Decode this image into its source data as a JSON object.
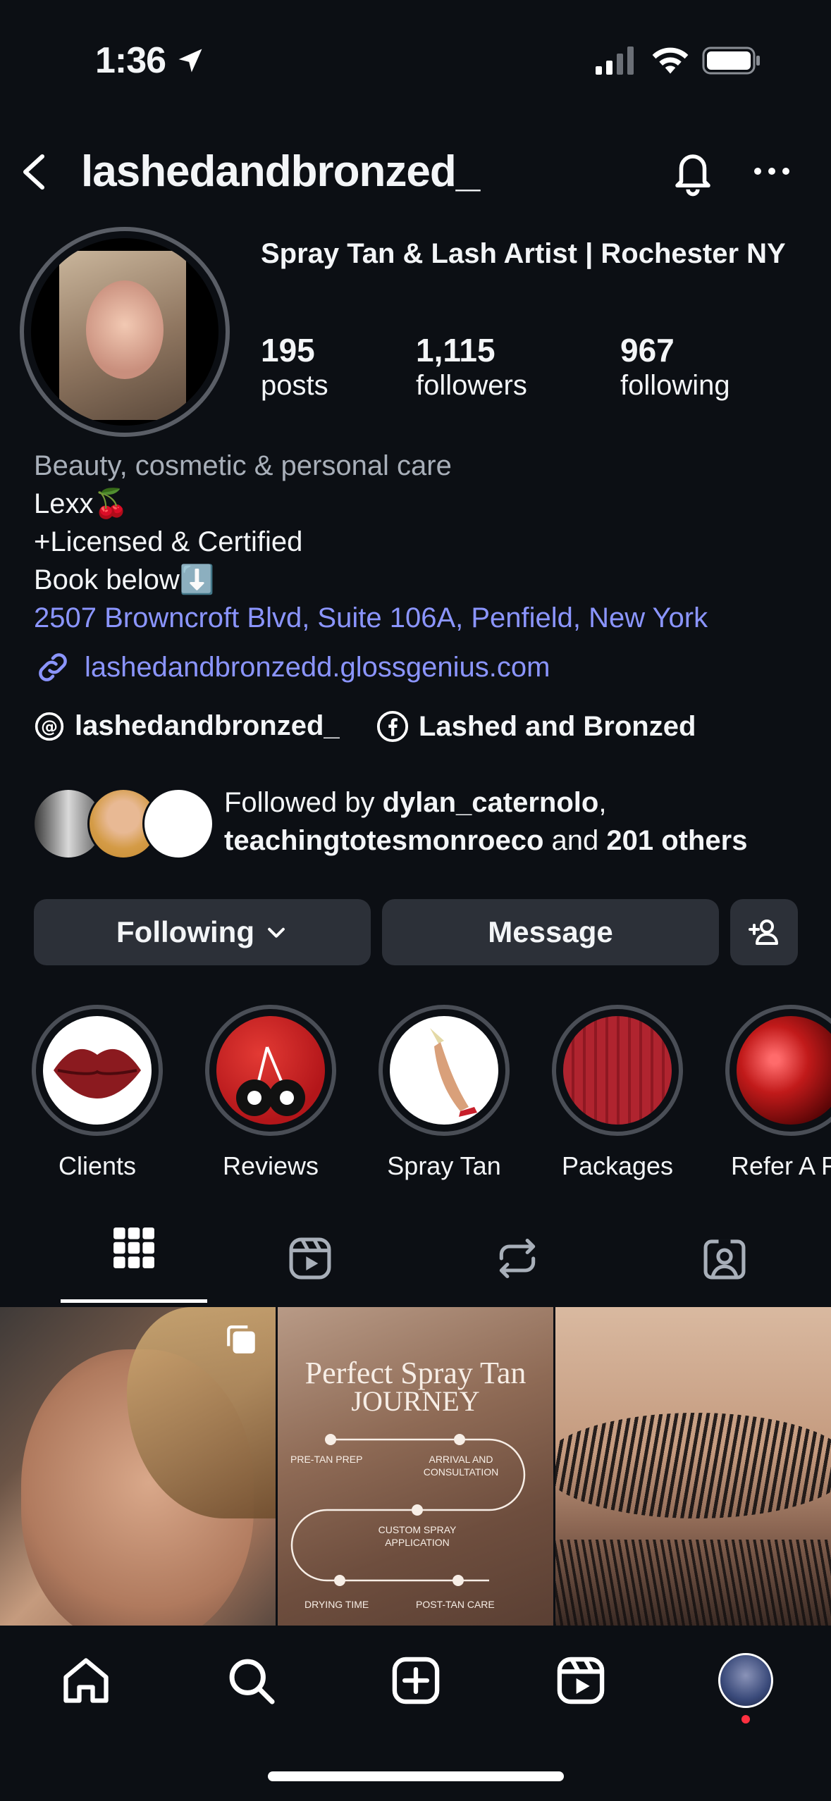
{
  "status_bar": {
    "time": "1:36"
  },
  "header": {
    "username": "lashedandbronzed_"
  },
  "profile": {
    "display_name": "Spray Tan & Lash Artist | Rochester NY",
    "stats": [
      {
        "value": "195",
        "label": "posts"
      },
      {
        "value": "1,115",
        "label": "followers"
      },
      {
        "value": "967",
        "label": "following"
      }
    ],
    "category": "Beauty, cosmetic & personal care",
    "bio_lines": [
      "Lexx🍒",
      "+Licensed & Certified",
      "Book below⬇️"
    ],
    "address": "2507 Browncroft Blvd, Suite 106A, Penfield, New York",
    "website": "lashedandbronzedd.glossgenius.com",
    "threads_handle": "lashedandbronzed_",
    "facebook_name": "Lashed and Bronzed",
    "followed_by": {
      "prefix": "Followed by ",
      "user1": "dylan_caternolo",
      "comma": ",",
      "user2": "teachingtotesmonroeco",
      "and": " and ",
      "others": "201 others"
    }
  },
  "actions": {
    "following": "Following",
    "message": "Message"
  },
  "highlights": [
    {
      "label": "Clients"
    },
    {
      "label": "Reviews"
    },
    {
      "label": "Spray Tan"
    },
    {
      "label": "Packages"
    },
    {
      "label": "Refer A Fri"
    }
  ],
  "posts": {
    "spray_tan_post": {
      "title_line1": "Perfect Spray Tan",
      "title_line2": "JOURNEY",
      "step1": "PRE-TAN PREP",
      "step2_a": "ARRIVAL AND",
      "step2_b": "CONSULTATION",
      "step3_a": "CUSTOM SPRAY",
      "step3_b": "APPLICATION",
      "step4": "DRYING TIME",
      "step5": "POST-TAN CARE"
    }
  },
  "colors": {
    "background": "#0c0f14",
    "link": "#8b95ff",
    "button": "#2c3038",
    "notification_dot": "#ff3040"
  }
}
